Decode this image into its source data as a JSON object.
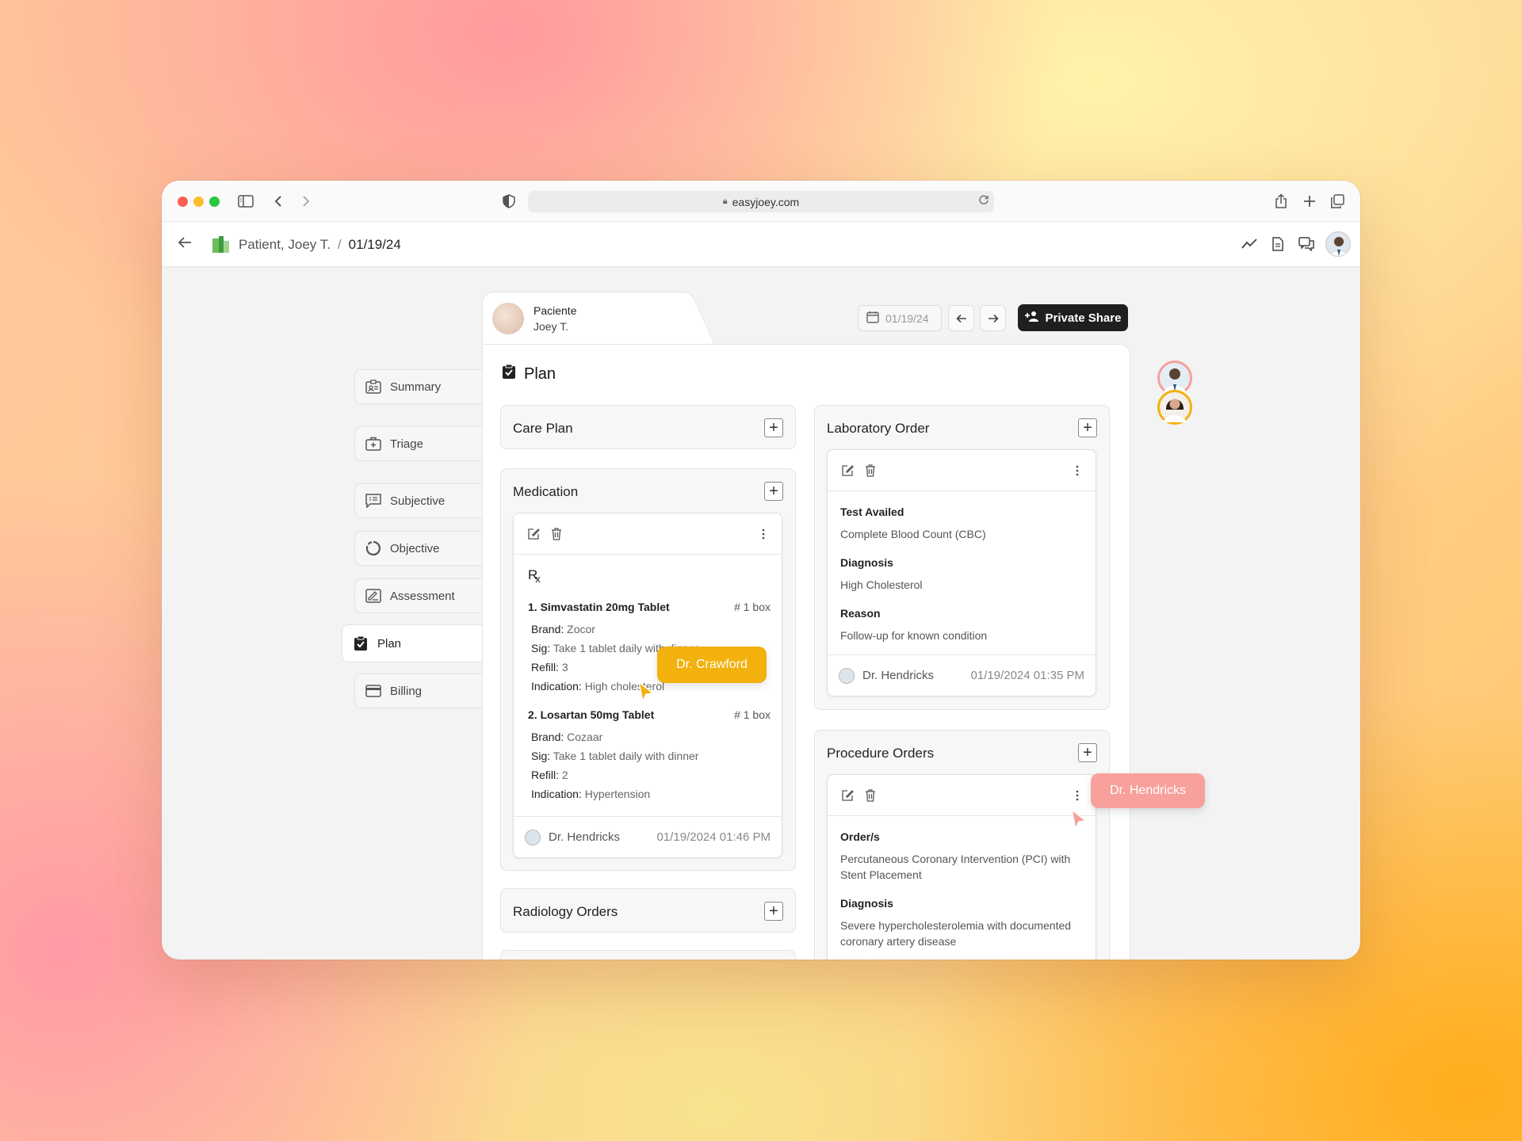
{
  "browser": {
    "url": "easyjoey.com",
    "colors": {
      "close": "#ff5f57",
      "minimize": "#febc2e",
      "maximize": "#28c840"
    }
  },
  "header": {
    "back_icon": "arrow-left-icon",
    "breadcrumb_patient": "Patient, Joey T.",
    "breadcrumb_sep": "/",
    "breadcrumb_date": "01/19/24",
    "icons": [
      "trend-icon",
      "document-icon",
      "chat-icon",
      "user-avatar"
    ]
  },
  "patient_tab": {
    "label": "Paciente",
    "name": "Joey T."
  },
  "toolbar": {
    "date": "01/19/24",
    "share_label": "Private Share"
  },
  "sidebar": {
    "items": [
      {
        "label": "Summary",
        "icon": "id-card-icon"
      },
      {
        "label": "Triage",
        "icon": "medical-kit-icon"
      },
      {
        "label": "Subjective",
        "icon": "chat-list-icon"
      },
      {
        "label": "Objective",
        "icon": "circle-progress-icon"
      },
      {
        "label": "Assessment",
        "icon": "signature-icon"
      },
      {
        "label": "Plan",
        "icon": "clipboard-check-icon",
        "active": true
      },
      {
        "label": "Billing",
        "icon": "credit-card-icon"
      }
    ]
  },
  "plan": {
    "title": "Plan",
    "care_plan": {
      "title": "Care Plan"
    },
    "medication": {
      "title": "Medication",
      "rx": "Rx",
      "items": [
        {
          "title": "1. Simvastatin 20mg Tablet",
          "qty": "# 1 box",
          "brand_label": "Brand:",
          "brand": "Zocor",
          "sig_label": "Sig:",
          "sig": "Take 1 tablet daily with dinner",
          "refill_label": "Refill:",
          "refill": "3",
          "indication_label": "Indication:",
          "indication": "High cholesterol"
        },
        {
          "title": "2. Losartan 50mg Tablet",
          "qty": "# 1 box",
          "brand_label": "Brand:",
          "brand": "Cozaar",
          "sig_label": "Sig:",
          "sig": "Take 1 tablet daily with dinner",
          "refill_label": "Refill:",
          "refill": "2",
          "indication_label": "Indication:",
          "indication": "Hypertension"
        }
      ],
      "author": "Dr. Hendricks",
      "timestamp": "01/19/2024 01:46 PM"
    },
    "radiology": {
      "title": "Radiology Orders"
    },
    "lab": {
      "title": "Laboratory Order",
      "test_label": "Test Availed",
      "test": "Complete Blood Count (CBC)",
      "diag_label": "Diagnosis",
      "diag": "High Cholesterol",
      "reason_label": "Reason",
      "reason": "Follow-up for known condition",
      "author": "Dr. Hendricks",
      "timestamp": "01/19/2024 01:35 PM"
    },
    "procedure": {
      "title": "Procedure Orders",
      "order_label": "Order/s",
      "order": "Percutaneous Coronary Intervention (PCI) with Stent Placement",
      "diag_label": "Diagnosis",
      "diag": "Severe hypercholesterolemia with documented coronary artery disease"
    }
  },
  "collaborators": {
    "crawford": {
      "name": "Dr. Crawford",
      "color": "#f2b10c"
    },
    "hendricks": {
      "name": "Dr. Hendricks",
      "color": "#f7a09c"
    }
  }
}
